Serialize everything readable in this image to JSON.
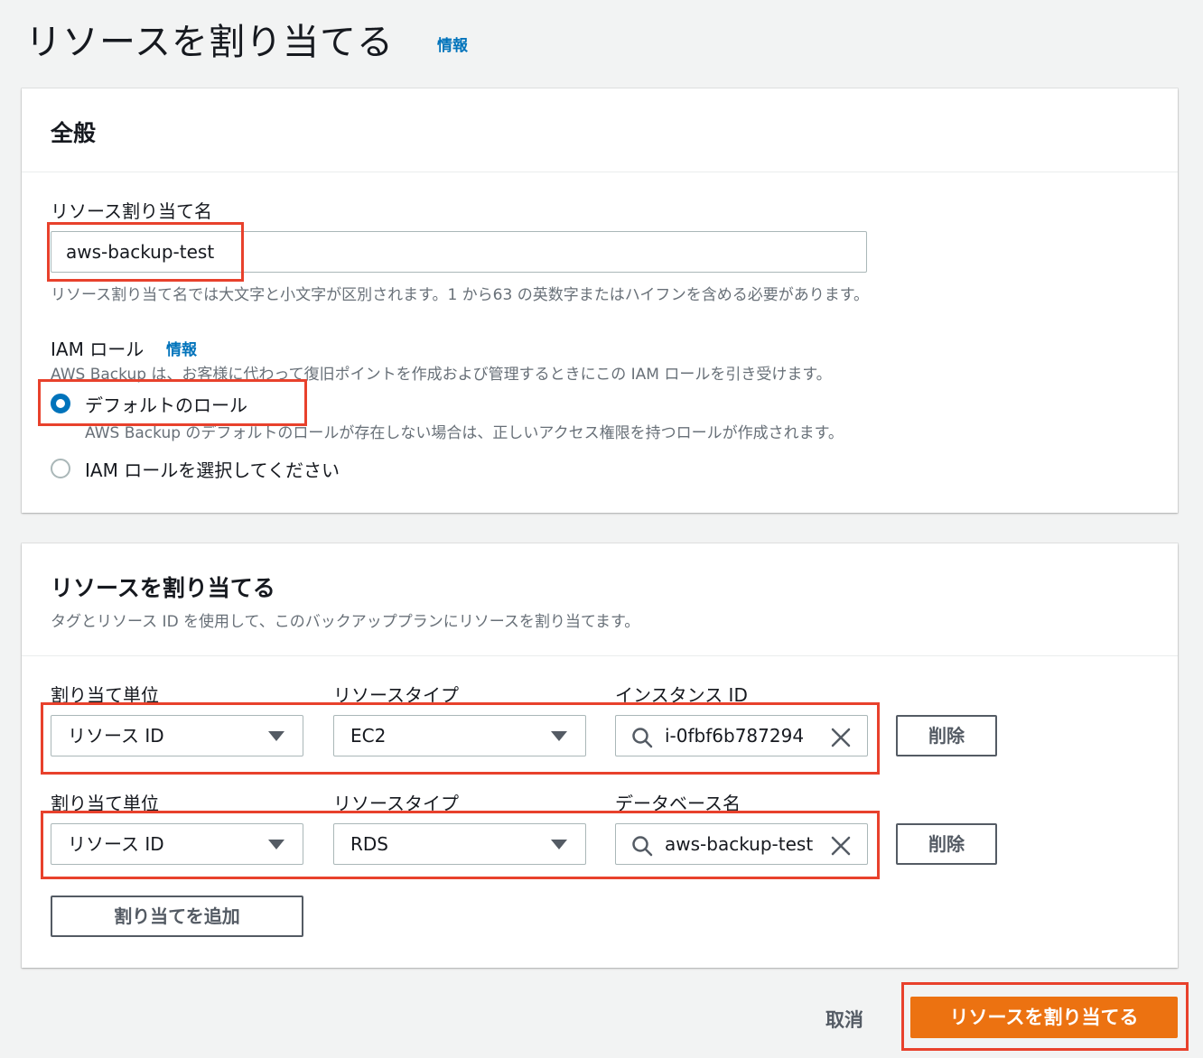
{
  "header": {
    "title": "リソースを割り当てる",
    "info": "情報"
  },
  "general": {
    "heading": "全般",
    "name_label": "リソース割り当て名",
    "name_value": "aws-backup-test",
    "name_hint": "リソース割り当て名では大文字と小文字が区別されます。1 から63 の英数字またはハイフンを含める必要があります。",
    "iam_label": "IAM ロール",
    "iam_info": "情報",
    "iam_desc": "AWS Backup は、お客様に代わって復旧ポイントを作成および管理するときにこの IAM ロールを引き受けます。",
    "options": [
      {
        "label": "デフォルトのロール",
        "desc": "AWS Backup のデフォルトのロールが存在しない場合は、正しいアクセス権限を持つロールが作成されます。",
        "selected": true
      },
      {
        "label": "IAM ロールを選択してください",
        "selected": false
      }
    ]
  },
  "assign": {
    "heading": "リソースを割り当てる",
    "desc": "タグとリソース ID を使用して、このバックアッププランにリソースを割り当てます。",
    "rows": [
      {
        "unit_label": "割り当て単位",
        "unit_value": "リソース ID",
        "type_label": "リソースタイプ",
        "type_value": "EC2",
        "id_label": "インスタンス ID",
        "id_value": "i-0fbf6b787294",
        "remove": "削除"
      },
      {
        "unit_label": "割り当て単位",
        "unit_value": "リソース ID",
        "type_label": "リソースタイプ",
        "type_value": "RDS",
        "id_label": "データベース名",
        "id_value": "aws-backup-test",
        "remove": "削除"
      }
    ],
    "add_button": "割り当てを追加"
  },
  "footer": {
    "cancel": "取消",
    "submit": "リソースを割り当てる"
  },
  "colors": {
    "accent": "#0073bb",
    "primary_button": "#ec7211",
    "highlight": "#e8412c"
  }
}
